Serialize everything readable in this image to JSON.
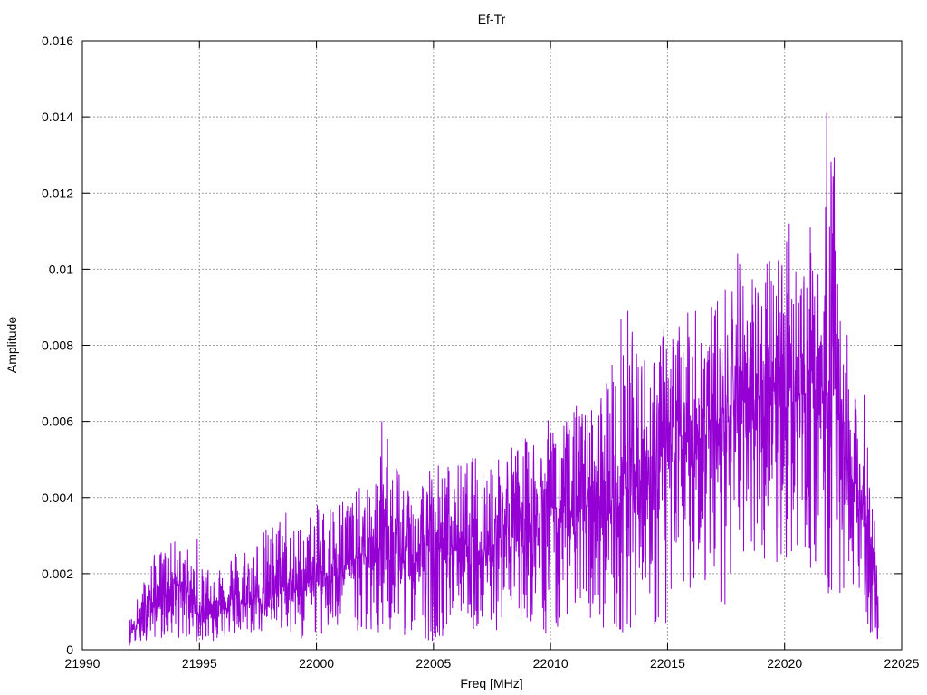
{
  "chart_data": {
    "type": "line",
    "title": "Ef-Tr",
    "xlabel": "Freq [MHz]",
    "ylabel": "Amplitude",
    "xlim": [
      21990,
      22025
    ],
    "ylim": [
      0,
      0.016
    ],
    "x_ticks": [
      "21990",
      "21995",
      "22000",
      "22005",
      "22010",
      "22015",
      "22020",
      "22025"
    ],
    "y_ticks": [
      "0",
      "0.002",
      "0.004",
      "0.006",
      "0.008",
      "0.01",
      "0.012",
      "0.014",
      "0.016"
    ],
    "grid": true,
    "legend": "none",
    "series_color": "#9400d3",
    "x_range": [
      21992.0,
      22024.0
    ],
    "series": [
      {
        "x": [
          21992.0,
          21993.0,
          21994.0,
          21994.5,
          21995.0,
          21996.0,
          21997.0,
          21998.0,
          21998.5,
          21999.0,
          22000.0,
          22001.0,
          22002.0,
          22002.5,
          22003.0,
          22004.0,
          22005.0,
          22006.0,
          22007.0,
          22008.0,
          22009.0,
          22010.0,
          22011.0,
          22012.0,
          22013.0,
          22014.0,
          22015.0,
          22016.0,
          22017.0,
          22018.0,
          22019.0,
          22020.0,
          22020.5,
          22021.0,
          22021.5,
          22022.0,
          22022.5,
          22023.0,
          22023.5,
          22024.0
        ],
        "y": [
          0.0004,
          0.0012,
          0.0018,
          0.0015,
          0.0009,
          0.0012,
          0.0013,
          0.0014,
          0.0018,
          0.0015,
          0.0019,
          0.0022,
          0.0025,
          0.0026,
          0.0027,
          0.0024,
          0.0028,
          0.0027,
          0.0026,
          0.003,
          0.0033,
          0.0038,
          0.0036,
          0.0037,
          0.0041,
          0.0045,
          0.0052,
          0.0055,
          0.0058,
          0.0065,
          0.0066,
          0.0069,
          0.0068,
          0.0065,
          0.0069,
          0.0068,
          0.0058,
          0.0041,
          0.0033,
          0.0012
        ],
        "upper": [
          0.0008,
          0.0025,
          0.0029,
          0.0027,
          0.0021,
          0.0026,
          0.0028,
          0.0033,
          0.0036,
          0.0032,
          0.0038,
          0.0041,
          0.0043,
          0.0044,
          0.0059,
          0.0044,
          0.005,
          0.0049,
          0.0052,
          0.0054,
          0.0056,
          0.0061,
          0.0063,
          0.0065,
          0.0089,
          0.0079,
          0.0087,
          0.0089,
          0.0092,
          0.0103,
          0.0099,
          0.0112,
          0.0107,
          0.0106,
          0.0099,
          0.0141,
          0.0091,
          0.0067,
          0.0057,
          0.0025
        ],
        "lower": [
          0.0001,
          0.0003,
          0.0003,
          0.0002,
          0.0001,
          0.0003,
          0.0004,
          0.0004,
          0.0005,
          0.0002,
          0.0003,
          0.0004,
          0.0005,
          0.0002,
          0.0003,
          0.0004,
          0.0002,
          0.0006,
          0.0005,
          0.0004,
          0.0007,
          0.0003,
          0.0008,
          0.0006,
          0.0004,
          0.0008,
          0.0003,
          0.0016,
          0.0014,
          0.0009,
          0.0018,
          0.002,
          0.0021,
          0.0022,
          0.0019,
          0.0009,
          0.0012,
          0.0018,
          0.0006,
          0.0001
        ],
        "spikes": [
          [
            21994.9,
            0.0029
          ],
          [
            21998.7,
            0.0036
          ],
          [
            22002.8,
            0.006
          ],
          [
            22010.1,
            0.0057
          ],
          [
            22011.1,
            0.0064
          ],
          [
            22013.3,
            0.0089
          ],
          [
            22016.2,
            0.0089
          ],
          [
            22018.0,
            0.0104
          ],
          [
            22020.2,
            0.0112
          ],
          [
            22021.1,
            0.0111
          ],
          [
            22021.8,
            0.0141
          ],
          [
            22022.0,
            0.0122
          ],
          [
            22023.4,
            0.0067
          ]
        ]
      }
    ]
  }
}
